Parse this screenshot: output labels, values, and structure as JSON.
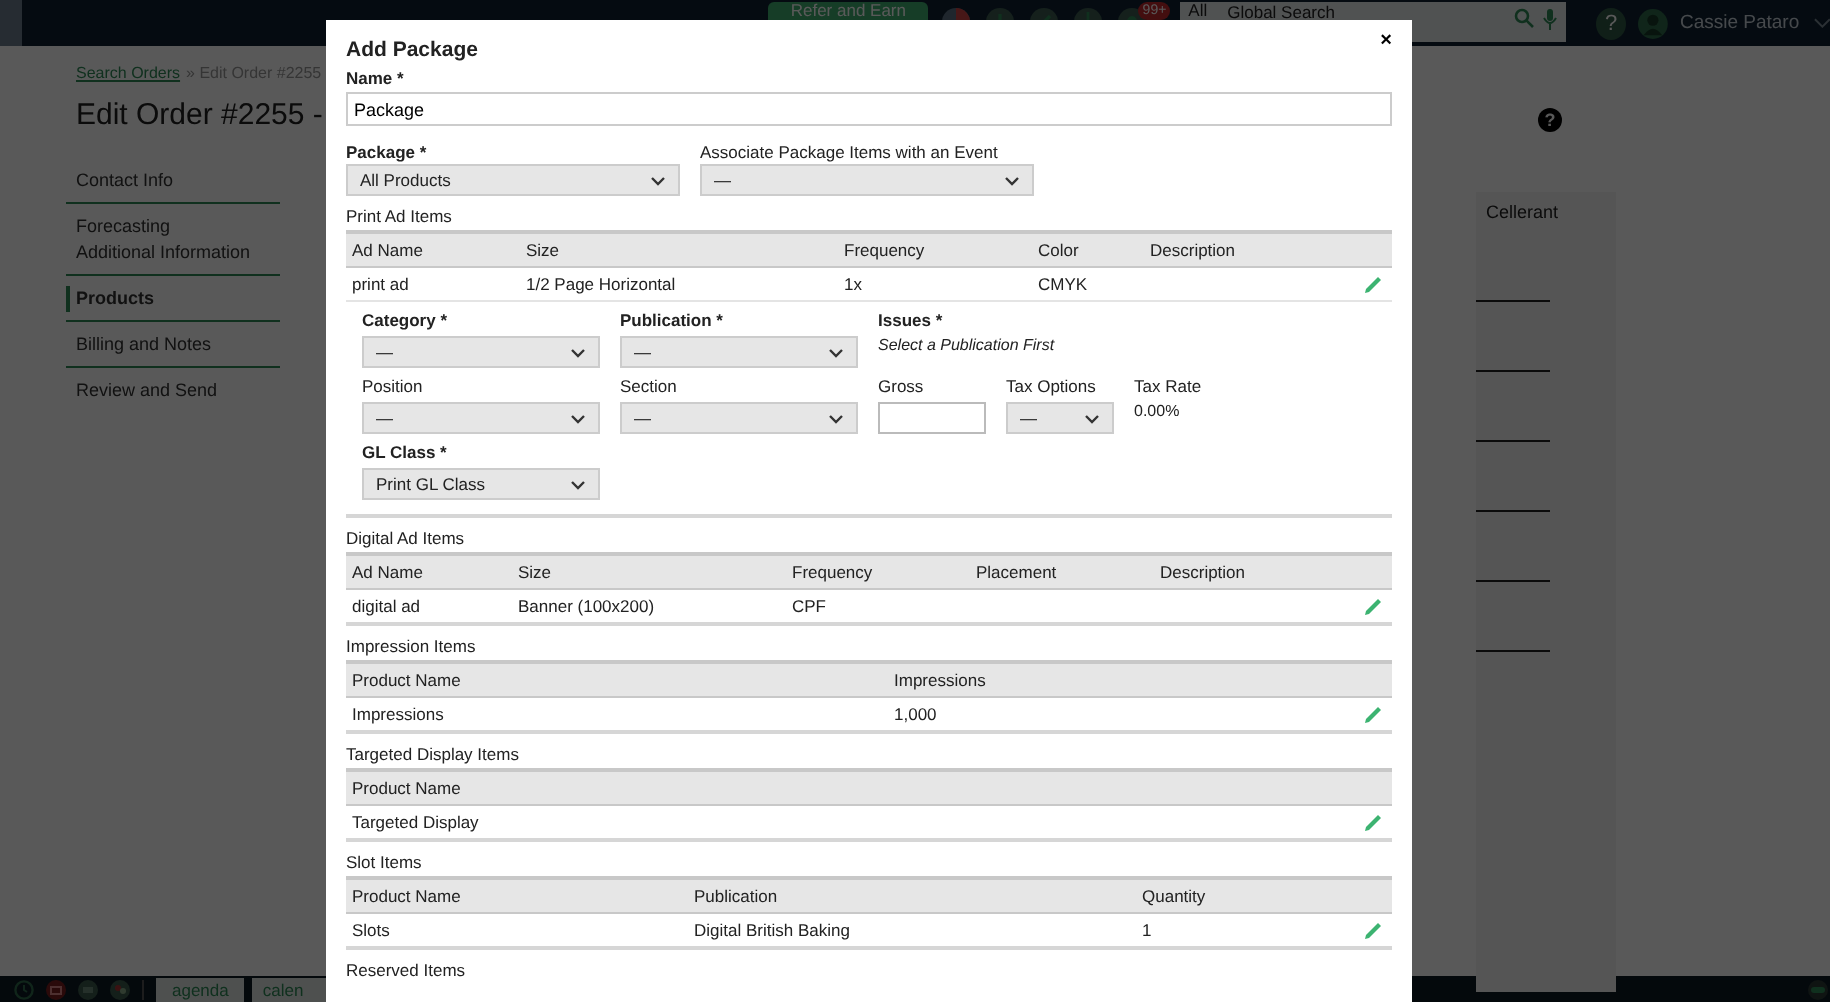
{
  "top_bar": {
    "refer_button": "Refer and Earn",
    "notification_badge": "99+",
    "search": {
      "scope": "All",
      "placeholder": "Global Search"
    },
    "help_icon": "?",
    "user_name": "Cassie Pataro"
  },
  "breadcrumb": {
    "link": "Search Orders",
    "current": "» Edit Order #2255"
  },
  "page_title": "Edit Order #2255 -",
  "sidebar": {
    "groups": [
      {
        "items": [
          {
            "label": "Contact Info",
            "selected": false
          }
        ]
      },
      {
        "items": [
          {
            "label": "Forecasting",
            "selected": false
          },
          {
            "label": "Additional Information",
            "selected": false
          }
        ]
      },
      {
        "items": [
          {
            "label": "Products",
            "selected": true
          }
        ]
      },
      {
        "items": [
          {
            "label": "Billing and Notes",
            "selected": false
          }
        ]
      },
      {
        "items": [
          {
            "label": "Review and Send",
            "selected": false
          }
        ]
      }
    ]
  },
  "right_panel": {
    "help_icon": "?",
    "tab": "Cellerant"
  },
  "bottom_bar": {
    "tabs": [
      "agenda",
      "calen"
    ]
  },
  "modal": {
    "title": "Add Package",
    "close": "×",
    "name_field": {
      "label": "Name *",
      "value": "Package"
    },
    "selects": [
      {
        "label": "Package *",
        "value": "All Products",
        "required": true
      },
      {
        "label": "Associate Package Items with an Event",
        "value": "—",
        "required": false
      }
    ],
    "sections": [
      {
        "title": "Print Ad Items",
        "columns": [
          "Ad Name",
          "Size",
          "Frequency",
          "Color",
          "Description"
        ],
        "rows": [
          {
            "cells": [
              "print ad",
              "1/2 Page Horizontal",
              "1x",
              "CMYK"
            ],
            "expanded": true
          }
        ],
        "editor": [
          [
            {
              "kind": "select",
              "label": "Category *",
              "required": true,
              "value": "—"
            },
            {
              "kind": "select",
              "label": "Publication *",
              "required": true,
              "value": "—"
            },
            {
              "kind": "note",
              "label": "Issues *",
              "required": true,
              "value": "Select a Publication First"
            }
          ],
          [
            {
              "kind": "select",
              "label": "Position",
              "required": false,
              "value": "—"
            },
            {
              "kind": "select",
              "label": "Section",
              "required": false,
              "value": "—"
            },
            {
              "kind": "input",
              "label": "Gross",
              "required": false
            },
            {
              "kind": "select",
              "label": "Tax Options",
              "required": false,
              "value": "—"
            },
            {
              "kind": "readout",
              "label": "Tax Rate",
              "required": false,
              "value": "0.00%"
            }
          ],
          [
            {
              "kind": "select",
              "label": "GL Class *",
              "required": true,
              "value": "Print GL Class"
            }
          ]
        ]
      },
      {
        "title": "Digital Ad Items",
        "columns": [
          "Ad Name",
          "Size",
          "Frequency",
          "Placement",
          "Description"
        ],
        "rows": [
          {
            "cells": [
              "digital ad",
              "Banner (100x200)",
              "CPF"
            ],
            "expanded": false
          }
        ]
      },
      {
        "title": "Impression Items",
        "columns": [
          "Product Name",
          "Impressions"
        ],
        "rows": [
          {
            "cells": [
              "Impressions",
              "1,000"
            ],
            "expanded": false
          }
        ]
      },
      {
        "title": "Targeted Display Items",
        "columns": [
          "Product Name"
        ],
        "rows": [
          {
            "cells": [
              "Targeted Display"
            ],
            "expanded": false
          }
        ]
      },
      {
        "title": "Slot Items",
        "columns": [
          "Product Name",
          "Publication",
          "Quantity"
        ],
        "rows": [
          {
            "cells": [
              "Slots",
              "Digital British Baking",
              "1"
            ],
            "expanded": false
          }
        ]
      },
      {
        "title": "Reserved Items"
      }
    ]
  }
}
